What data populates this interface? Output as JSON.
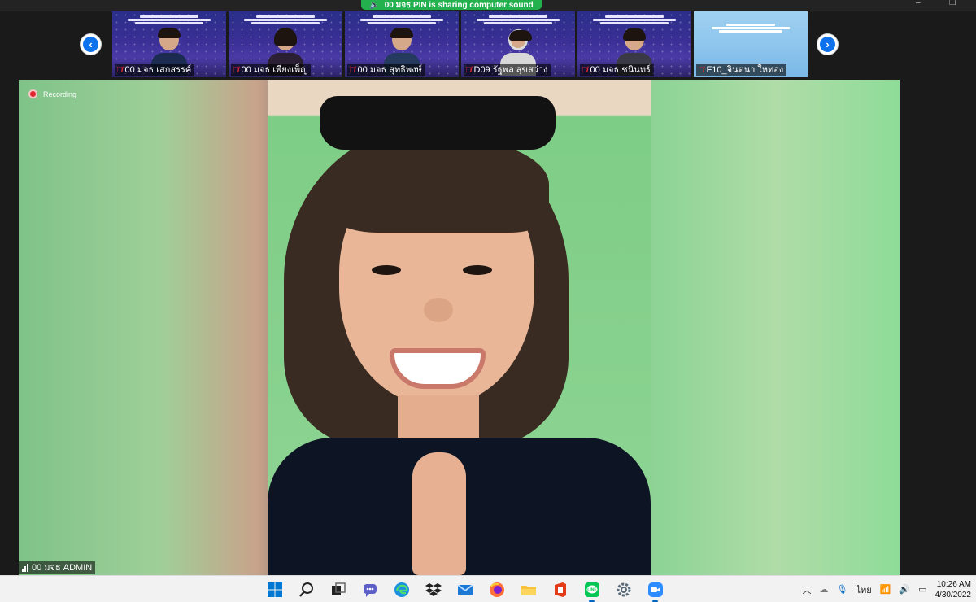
{
  "share_banner": {
    "text": "00 มจธ PIN is sharing computer sound"
  },
  "window_controls": {
    "minimize": "–",
    "restore": "❐"
  },
  "gallery": {
    "prev_label": "‹",
    "next_label": "›",
    "participants": [
      {
        "name": "00 มจธ เสกสรรค์",
        "muted": true,
        "theme": "dark"
      },
      {
        "name": "00 มจธ เพียงเพ็ญ",
        "muted": true,
        "theme": "dark"
      },
      {
        "name": "00 มจธ สุทธิพงษ์",
        "muted": true,
        "theme": "dark"
      },
      {
        "name": "D09 รัฐพล สุขสว่าง",
        "muted": true,
        "theme": "dark"
      },
      {
        "name": "00 มจธ ชนินทร์",
        "muted": true,
        "theme": "dark"
      },
      {
        "name": "F10_จินตนา ใหทอง",
        "muted": true,
        "theme": "light"
      }
    ]
  },
  "main": {
    "recording_label": "Recording",
    "speaker_name": "00 มจธ ADMIN"
  },
  "taskbar": {
    "apps": [
      {
        "name": "start",
        "icon": "windows-icon",
        "active": false
      },
      {
        "name": "search",
        "icon": "search-icon",
        "active": false
      },
      {
        "name": "task-view",
        "icon": "task-view-icon",
        "active": false
      },
      {
        "name": "teams-chat",
        "icon": "chat-icon",
        "active": false
      },
      {
        "name": "edge",
        "icon": "edge-icon",
        "active": false
      },
      {
        "name": "dropbox",
        "icon": "dropbox-icon",
        "active": false
      },
      {
        "name": "mail",
        "icon": "mail-icon",
        "active": false
      },
      {
        "name": "firefox",
        "icon": "firefox-icon",
        "active": false
      },
      {
        "name": "file-explorer",
        "icon": "folder-icon",
        "active": false
      },
      {
        "name": "office",
        "icon": "office-icon",
        "active": false
      },
      {
        "name": "line",
        "icon": "line-icon",
        "active": true
      },
      {
        "name": "settings",
        "icon": "gear-icon",
        "active": false
      },
      {
        "name": "zoom",
        "icon": "zoom-icon",
        "active": true
      }
    ],
    "tray": {
      "language": "ไทย",
      "time": "10:26 AM",
      "date": "4/30/2022"
    }
  },
  "colors": {
    "zoom_blue": "#0e72ed",
    "share_green": "#23b14d",
    "muted_red": "#e0282f"
  }
}
